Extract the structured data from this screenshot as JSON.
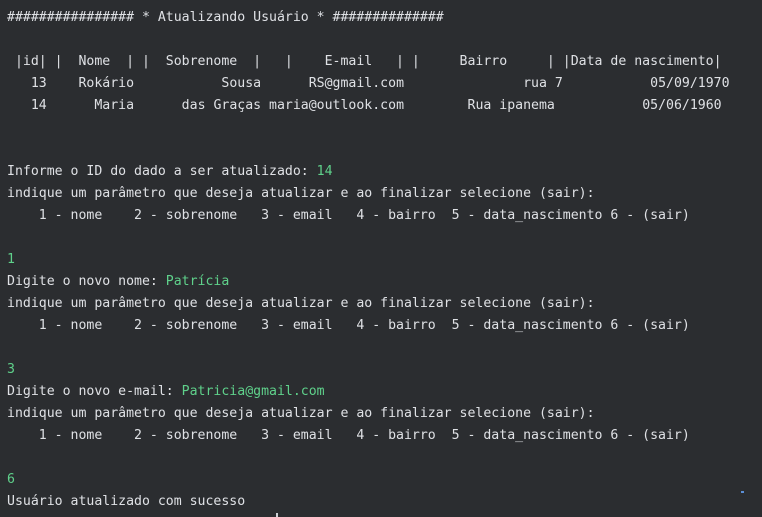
{
  "console": {
    "header": "################ * Atualizando Usuário * ##############",
    "table_header": " |id| |  Nome  | |  Sobrenome  |   |    E-mail   | |     Bairro     | |Data de nascimento|",
    "rows": [
      {
        "id": "   13",
        "nome": "    Rokário",
        "sobrenome": "           Sousa",
        "email": "      RS@gmail.com",
        "bairro": "               rua 7",
        "data": "           05/09/1970"
      },
      {
        "id": "   14",
        "nome": "      Maria",
        "sobrenome": "      das Graças",
        "email": " maria@outlook.com",
        "bairro": "        Rua ipanema",
        "data": "           05/06/1960"
      }
    ],
    "prompt_id": "Informe o ID do dado a ser atualizado: ",
    "input_id": "14",
    "param_prompt": "indique um parâmetro que deseja atualizar e ao finalizar selecione (sair):",
    "options": "    1 - nome    2 - sobrenome   3 - email   4 - bairro  5 - data_nascimento 6 - (sair)",
    "choice_1": "1",
    "prompt_nome": "Digite o novo nome: ",
    "input_nome": "Patrícia",
    "choice_2": "3",
    "prompt_email": "Digite o novo e-mail: ",
    "input_email": "Patricia@gmail.com",
    "choice_3": "6",
    "success": "Usuário atualizado com sucesso"
  },
  "colors": {
    "background": "#2b2d30",
    "text": "#dfe1e5",
    "user_input": "#5fd18b"
  }
}
